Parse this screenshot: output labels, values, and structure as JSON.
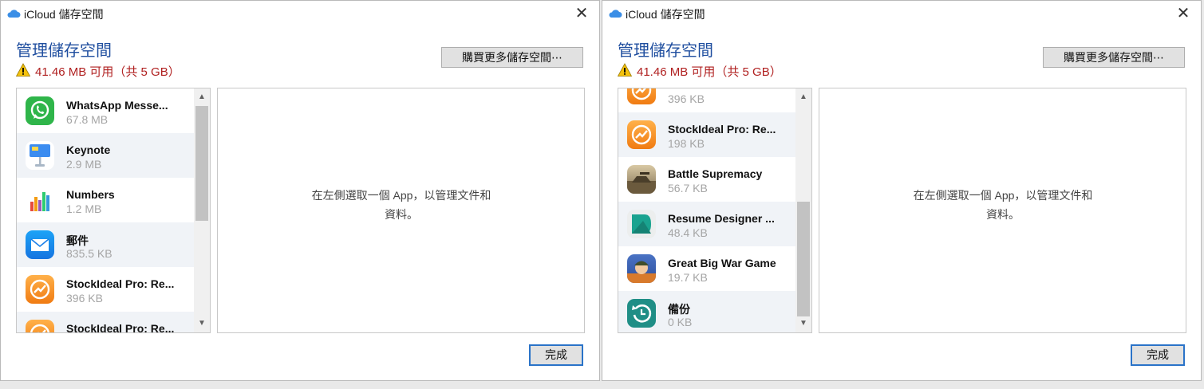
{
  "windows": [
    {
      "title": "iCloud 儲存空間",
      "heading": "管理儲存空間",
      "storage_text": "41.46 MB 可用（共 5 GB）",
      "buy_button": "購買更多儲存空間⋯",
      "placeholder_line1": "在左側選取一個 App，以管理文件和",
      "placeholder_line2": "資料。",
      "done_button": "完成",
      "apps": [
        {
          "name": "WhatsApp Messe...",
          "size": "67.8 MB",
          "icon": "whatsapp-icon"
        },
        {
          "name": "Keynote",
          "size": "2.9 MB",
          "icon": "keynote-icon"
        },
        {
          "name": "Numbers",
          "size": "1.2 MB",
          "icon": "numbers-icon"
        },
        {
          "name": "郵件",
          "size": "835.5 KB",
          "icon": "mail-icon"
        },
        {
          "name": "StockIdeal Pro: Re...",
          "size": "396 KB",
          "icon": "stockideal-icon"
        },
        {
          "name": "StockIdeal Pro: Re...",
          "size": "",
          "icon": "stockideal-icon"
        }
      ]
    },
    {
      "title": "iCloud 儲存空間",
      "heading": "管理儲存空間",
      "storage_text": "41.46 MB 可用（共 5 GB）",
      "buy_button": "購買更多儲存空間⋯",
      "placeholder_line1": "在左側選取一個 App，以管理文件和",
      "placeholder_line2": "資料。",
      "done_button": "完成",
      "apps": [
        {
          "name": "",
          "size": "396 KB",
          "icon": "stockideal-icon"
        },
        {
          "name": "StockIdeal Pro: Re...",
          "size": "198 KB",
          "icon": "stockideal-icon"
        },
        {
          "name": "Battle Supremacy",
          "size": "56.7 KB",
          "icon": "battle-supremacy-icon"
        },
        {
          "name": "Resume Designer ...",
          "size": "48.4 KB",
          "icon": "resume-designer-icon"
        },
        {
          "name": "Great Big War Game",
          "size": "19.7 KB",
          "icon": "great-big-war-game-icon"
        },
        {
          "name": "備份",
          "size": "0 KB",
          "icon": "backup-icon"
        }
      ]
    }
  ],
  "colors": {
    "heading": "#1f4e9f",
    "warning_text": "#b02020",
    "accent_border": "#2a73c8"
  }
}
